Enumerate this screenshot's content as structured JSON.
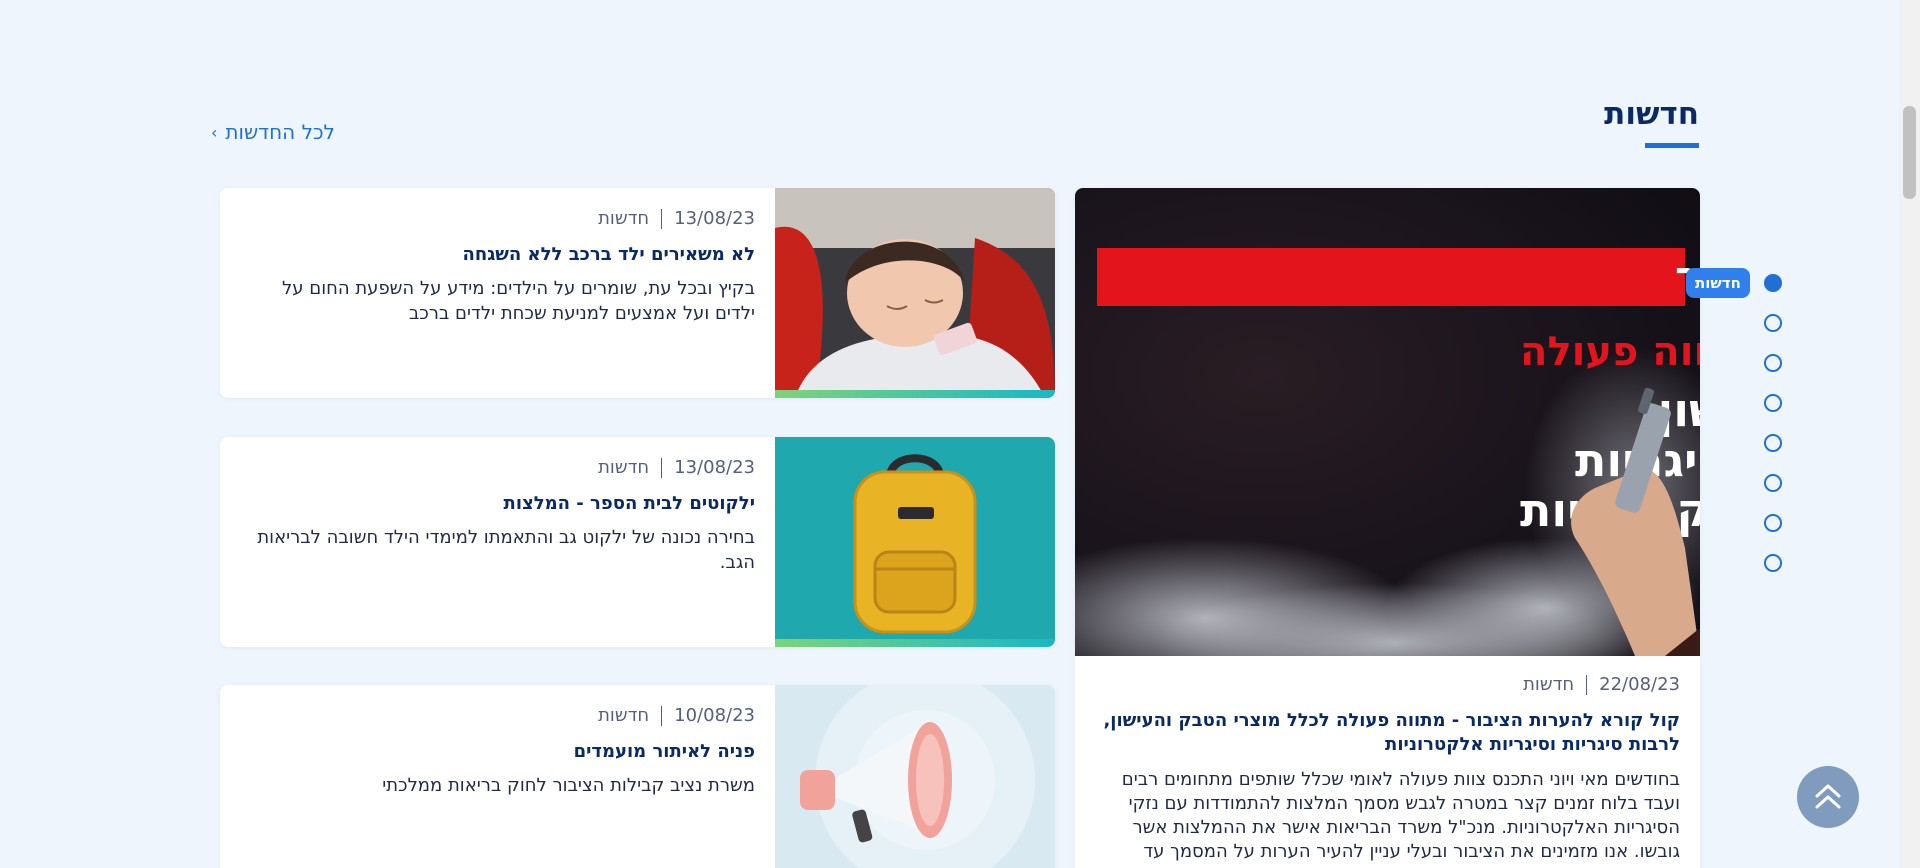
{
  "section": {
    "title": "חדשות",
    "all_news_label": "לכל החדשות"
  },
  "featured": {
    "hero": {
      "banner": "קול קורא להערות הציבור",
      "subtitle": "מתווה פעולה",
      "lines": [
        "למוצרי הטבק והעישון,",
        "סיגריות וסיגריות",
        "אלקטרוניות"
      ]
    },
    "date": "22/08/23",
    "category": "חדשות",
    "title": "קול קורא להערות הציבור - מתווה פעולה לכלל מוצרי הטבק והעישון, לרבות סיגריות וסיגריות אלקטרוניות",
    "body": "בחודשים מאי ויוני התכנס צוות פעולה לאומי שכלל שותפים מתחומים רבים ועבד בלוח זמנים קצר במטרה לגבש מסמך המלצות להתמודדות עם נזקי הסיגריות האלקטרוניות. מנכ\"ל משרד הבריאות אישר את ההמלצות אשר גובשו. אנו מזמינים את הציבור ובעלי עניין להעיר הערות על המסמך עד"
  },
  "news": [
    {
      "date": "13/08/23",
      "category": "חדשות",
      "title": "לא משאירים ילד ברכב ללא השגחה",
      "body": "בקיץ ובכל עת, שומרים על הילדים: מידע על השפעת החום על ילדים ועל אמצעים למניעת שכחת ילדים ברכב"
    },
    {
      "date": "13/08/23",
      "category": "חדשות",
      "title": "ילקוטים לבית הספר - המלצות",
      "body": "בחירה נכונה של ילקוט גב והתאמתו למימדי הילד חשובה לבריאות הגב."
    },
    {
      "date": "10/08/23",
      "category": "חדשות",
      "title": "פניה לאיתור מועמדים",
      "body": "משרת נציב קבילות הציבור לחוק בריאות ממלכתי"
    }
  ],
  "navigator": {
    "active_label": "חדשות",
    "dot_count": 8,
    "active_index": 0
  },
  "colors": {
    "accent": "#1f6fd6",
    "title": "#0a2a66",
    "background": "#eef5fc",
    "banner_red": "#e3141b"
  },
  "icons": {
    "all_news": "chevron-left-icon",
    "to_top": "double-chevron-up-icon"
  }
}
